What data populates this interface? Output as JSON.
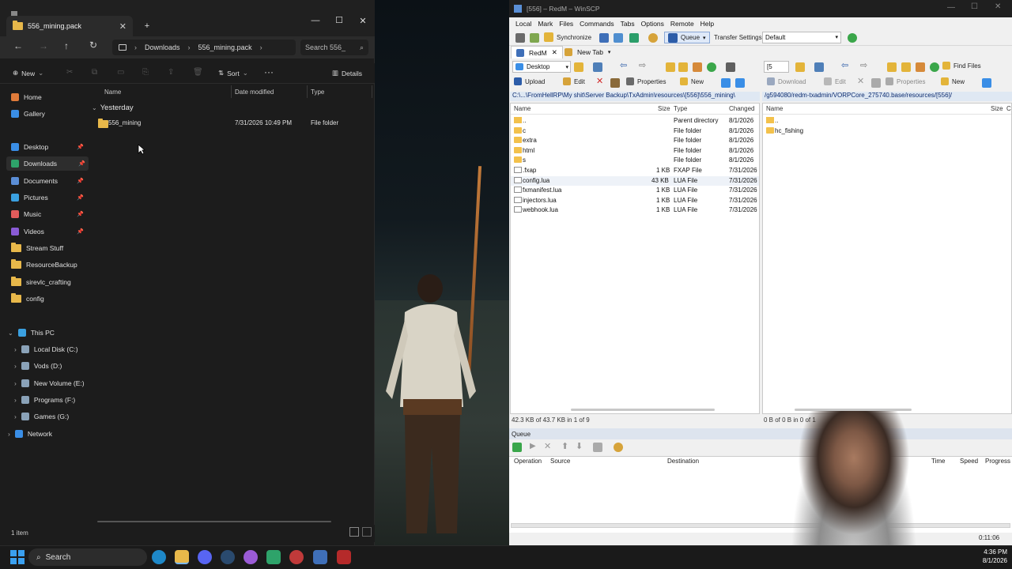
{
  "explorer": {
    "tab_title": "556_mining.pack",
    "breadcrumb": [
      "Downloads",
      "556_mining.pack"
    ],
    "search_placeholder": "Search 556_",
    "toolbar": {
      "new": "New",
      "sort": "Sort",
      "details": "Details"
    },
    "sidebar": {
      "top": [
        {
          "label": "Home",
          "icon": "home-icon"
        },
        {
          "label": "Gallery",
          "icon": "gallery-icon"
        }
      ],
      "pinned": [
        {
          "label": "Desktop",
          "icon": "desktop-icon",
          "color": "#3a8ee6"
        },
        {
          "label": "Downloads",
          "icon": "download-icon",
          "color": "#2ea36a"
        },
        {
          "label": "Documents",
          "icon": "document-icon",
          "color": "#5b8ed6"
        },
        {
          "label": "Pictures",
          "icon": "pictures-icon",
          "color": "#3aa0e0"
        },
        {
          "label": "Music",
          "icon": "music-icon",
          "color": "#e25b5b"
        },
        {
          "label": "Videos",
          "icon": "videos-icon",
          "color": "#8a5bd6"
        }
      ],
      "folders": [
        "Stream Stuff",
        "ResourceBackup",
        "sirevlc_crafting",
        "config"
      ],
      "this_pc": "This PC",
      "drives": [
        "Local Disk (C:)",
        "Vods (D:)",
        "New Volume (E:)",
        "Programs (F:)",
        "Games (G:)"
      ],
      "network": "Network"
    },
    "columns": {
      "name": "Name",
      "date": "Date modified",
      "type": "Type"
    },
    "group": "Yesterday",
    "files": [
      {
        "name": "556_mining",
        "date": "7/31/2026 10:49 PM",
        "type": "File folder"
      }
    ],
    "status": "1 item"
  },
  "winscp": {
    "title": "[556] – RedM – WinSCP",
    "menu": [
      "Local",
      "Mark",
      "Files",
      "Commands",
      "Tabs",
      "Options",
      "Remote",
      "Help"
    ],
    "toolbar1": {
      "synchronize": "Synchronize",
      "queue": "Queue",
      "transfer_settings": "Transfer Settings",
      "transfer_value": "Default"
    },
    "tabs": [
      "RedM",
      "New Tab"
    ],
    "local_location": "Desktop",
    "remote_location": "[5",
    "find_files": "Find Files",
    "local_actions": {
      "upload": "Upload",
      "edit": "Edit",
      "properties": "Properties",
      "new": "New"
    },
    "remote_actions": {
      "download": "Download",
      "edit": "Edit",
      "properties": "Properties",
      "new": "New"
    },
    "local_path": "C:\\...\\FromHellRP\\My shit\\Server Backup\\TxAdmin\\resources\\[556]\\556_mining\\",
    "remote_path": "/g594080/redm-txadmin/VORPCore_275740.base/resources/[556]/",
    "local_columns": {
      "name": "Name",
      "size": "Size",
      "type": "Type",
      "changed": "Changed"
    },
    "remote_columns": {
      "name": "Name",
      "size": "Size",
      "changed": "C"
    },
    "local_files": [
      {
        "name": "..",
        "size": "",
        "type": "Parent directory",
        "changed": "8/1/2026",
        "kind": "up"
      },
      {
        "name": "c",
        "size": "",
        "type": "File folder",
        "changed": "8/1/2026",
        "kind": "folder"
      },
      {
        "name": "extra",
        "size": "",
        "type": "File folder",
        "changed": "8/1/2026",
        "kind": "folder"
      },
      {
        "name": "html",
        "size": "",
        "type": "File folder",
        "changed": "8/1/2026",
        "kind": "folder"
      },
      {
        "name": "s",
        "size": "",
        "type": "File folder",
        "changed": "8/1/2026",
        "kind": "folder"
      },
      {
        "name": ".fxap",
        "size": "1 KB",
        "type": "FXAP File",
        "changed": "7/31/2026",
        "kind": "file"
      },
      {
        "name": "config.lua",
        "size": "43 KB",
        "type": "LUA File",
        "changed": "7/31/2026",
        "kind": "file"
      },
      {
        "name": "fxmanifest.lua",
        "size": "1 KB",
        "type": "LUA File",
        "changed": "7/31/2026",
        "kind": "file"
      },
      {
        "name": "injectors.lua",
        "size": "1 KB",
        "type": "LUA File",
        "changed": "7/31/2026",
        "kind": "file"
      },
      {
        "name": "webhook.lua",
        "size": "1 KB",
        "type": "LUA File",
        "changed": "7/31/2026",
        "kind": "file"
      }
    ],
    "remote_files": [
      {
        "name": "..",
        "kind": "up"
      },
      {
        "name": "hc_fishing",
        "kind": "folder"
      }
    ],
    "local_status": "42.3 KB of 43.7 KB in 1 of 9",
    "remote_status": "0 B of 0 B in 0 of 1",
    "queue_label": "Queue",
    "queue_columns": {
      "operation": "Operation",
      "source": "Source",
      "destination": "Destination",
      "time": "Time",
      "speed": "Speed",
      "progress": "Progress"
    },
    "elapsed": "0:11:06"
  },
  "taskbar": {
    "search": "Search",
    "time": "4:36 PM",
    "date": "8/1/2026"
  }
}
